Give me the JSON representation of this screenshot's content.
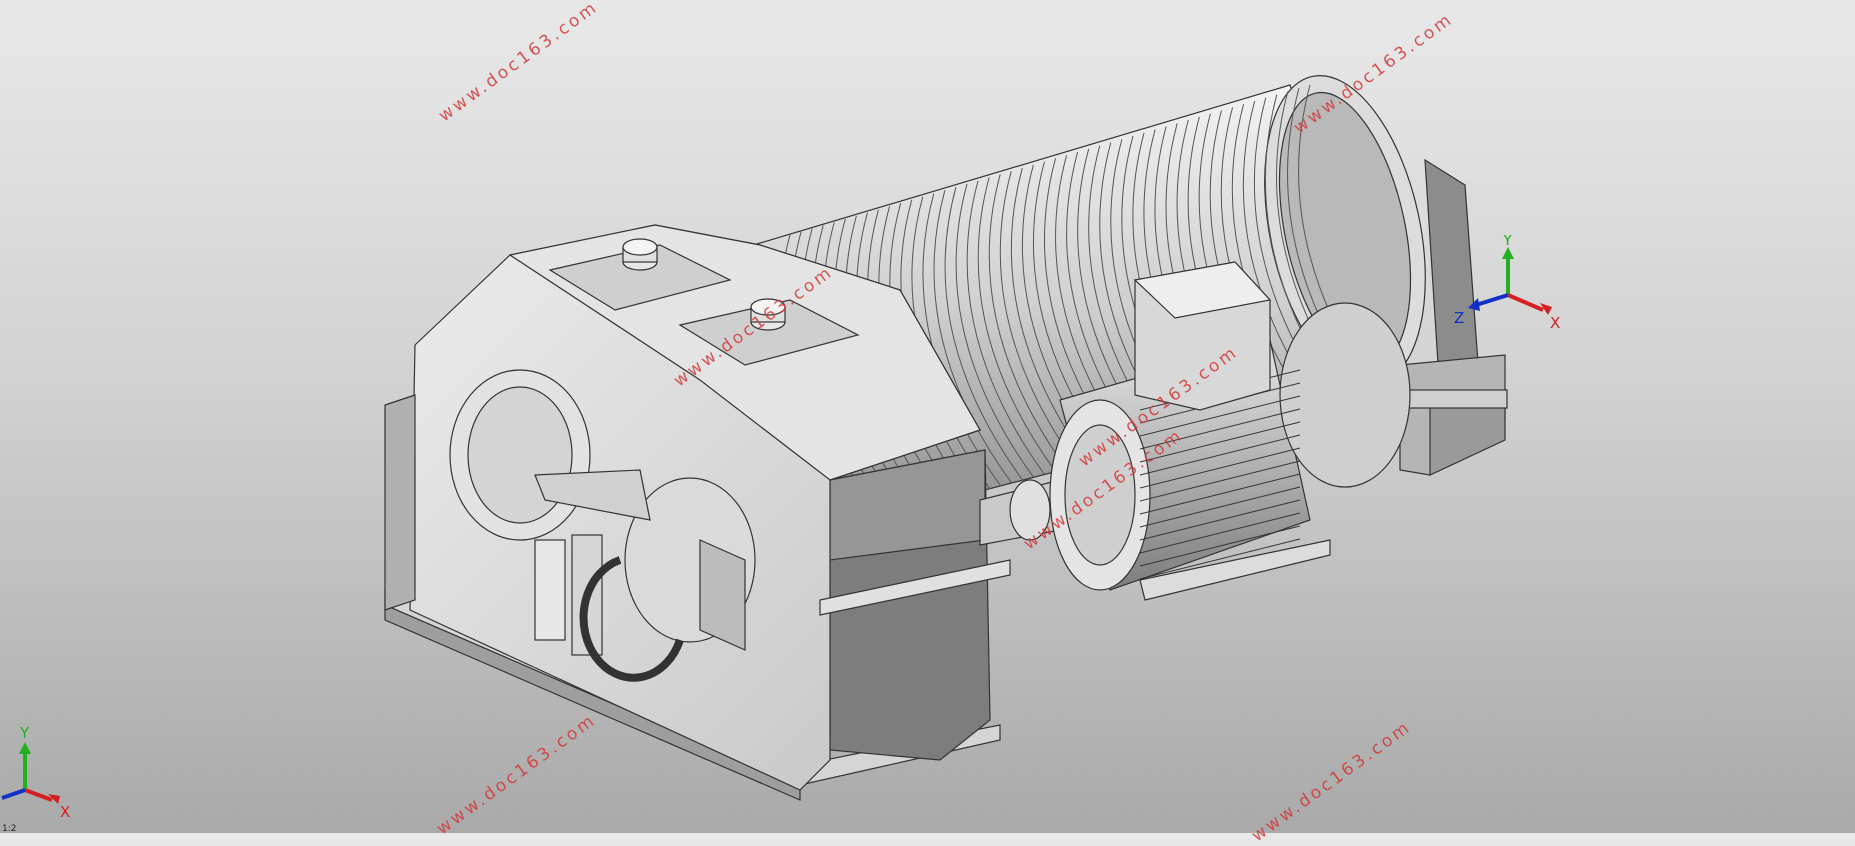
{
  "watermarks": [
    "www.doc163.com",
    "www.doc163.com",
    "www.doc163.com",
    "www.doc163.com",
    "www.doc163.com",
    "www.doc163.com",
    "www.doc163.com"
  ],
  "triad_main": {
    "x": "X",
    "y": "Y",
    "z": "Z"
  },
  "triad_corner": {
    "x": "X",
    "y": "Y"
  },
  "colors": {
    "x_axis": "#d42020",
    "y_axis": "#20b020",
    "z_axis": "#1030c8",
    "watermark": "#d43a3a"
  },
  "status": "1:2"
}
